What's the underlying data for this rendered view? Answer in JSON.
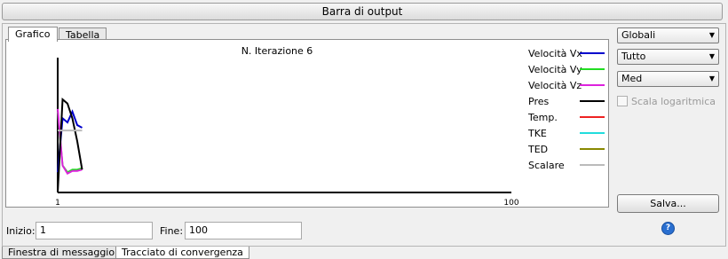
{
  "window": {
    "title": "Barra di output"
  },
  "tabs": [
    {
      "label": "Grafico",
      "active": true
    },
    {
      "label": "Tabella",
      "active": false
    }
  ],
  "chart_data": {
    "type": "line",
    "title": "N. Iterazione 6",
    "xlabel": "",
    "ylabel": "",
    "xlim": [
      1,
      100
    ],
    "xticks": [
      "1",
      "100"
    ],
    "grid": false,
    "legend_position": "right",
    "x": [
      1,
      2,
      3,
      4,
      5,
      6
    ],
    "series": [
      {
        "name": "Velocità Vx",
        "color": "#0000cc",
        "values": [
          0.15,
          0.55,
          0.52,
          0.6,
          0.5,
          0.48
        ]
      },
      {
        "name": "Velocità Vy",
        "color": "#22dd22",
        "values": [
          0.6,
          0.2,
          0.15,
          0.17,
          0.17,
          0.18
        ]
      },
      {
        "name": "Velocità Vz",
        "color": "#dd22dd",
        "values": [
          0.62,
          0.2,
          0.14,
          0.16,
          0.16,
          0.17
        ]
      },
      {
        "name": "Pres",
        "color": "#000000",
        "values": [
          0.0,
          0.69,
          0.66,
          0.55,
          0.38,
          0.17
        ]
      },
      {
        "name": "Temp.",
        "color": "#ee2222",
        "values": []
      },
      {
        "name": "TKE",
        "color": "#22dddd",
        "values": []
      },
      {
        "name": "TED",
        "color": "#888800",
        "values": []
      },
      {
        "name": "Scalare",
        "color": "#bbbbbb",
        "values": [
          0.46,
          0.46,
          0.46,
          0.46,
          0.46,
          0.46
        ]
      }
    ]
  },
  "controls": {
    "dropdown1": "Globali",
    "dropdown2": "Tutto",
    "dropdown3": "Med",
    "log_scale_label": "Scala logaritmica",
    "log_scale_checked": false,
    "save_label": "Salva...",
    "help_glyph": "?"
  },
  "range": {
    "start_label": "Inizio:",
    "start_value": "1",
    "end_label": "Fine:",
    "end_value": "100"
  },
  "bottom_tabs": [
    {
      "label": "Finestra di messaggio",
      "active": false
    },
    {
      "label": "Tracciato di convergenza",
      "active": true
    }
  ]
}
